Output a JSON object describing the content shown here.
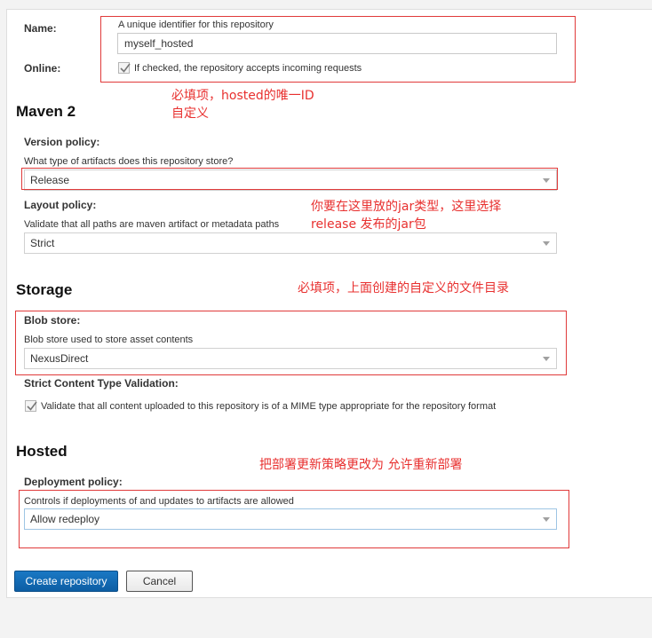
{
  "form": {
    "name": {
      "label": "Name:",
      "help": "A unique identifier for this repository",
      "value": "myself_hosted"
    },
    "online": {
      "label": "Online:",
      "checked": true,
      "text": "If checked, the repository accepts incoming requests"
    }
  },
  "maven2": {
    "title": "Maven 2",
    "version_policy": {
      "label": "Version policy:",
      "help": "What type of artifacts does this repository store?",
      "value": "Release"
    },
    "layout_policy": {
      "label": "Layout policy:",
      "help": "Validate that all paths are maven artifact or metadata paths",
      "value": "Strict"
    }
  },
  "storage": {
    "title": "Storage",
    "blob_store": {
      "label": "Blob store:",
      "help": "Blob store used to store asset contents",
      "value": "NexusDirect"
    },
    "strict_validation": {
      "label": "Strict Content Type Validation:",
      "checked": true,
      "text": "Validate that all content uploaded to this repository is of a MIME type appropriate for the repository format"
    }
  },
  "hosted": {
    "title": "Hosted",
    "deployment_policy": {
      "label": "Deployment policy:",
      "help": "Controls if deployments of and updates to artifacts are allowed",
      "value": "Allow redeploy"
    }
  },
  "actions": {
    "create_label": "Create repository",
    "cancel_label": "Cancel"
  },
  "annotations": {
    "name_note_line1": "必填项，hosted的唯一ID",
    "name_note_line2": "自定义",
    "version_note_line1": "你要在这里放的jar类型，这里选择",
    "version_note_line2": "release  发布的jar包",
    "storage_note": "必填项，上面创建的自定义的文件目录",
    "deploy_note": "把部署更新策略更改为  允许重新部署",
    "highlight_color": "#e03a3a"
  }
}
